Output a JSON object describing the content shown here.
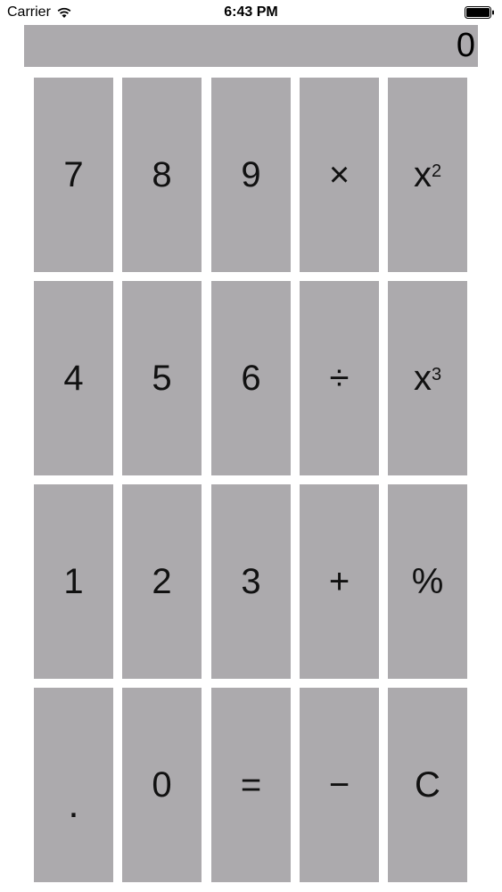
{
  "status_bar": {
    "carrier": "Carrier",
    "time": "6:43 PM"
  },
  "display": {
    "value": "0"
  },
  "keys": [
    {
      "label": "7",
      "name": "key-7"
    },
    {
      "label": "8",
      "name": "key-8"
    },
    {
      "label": "9",
      "name": "key-9"
    },
    {
      "label": "×",
      "name": "key-multiply"
    },
    {
      "label": "x",
      "sup": "2",
      "name": "key-square"
    },
    {
      "label": "4",
      "name": "key-4"
    },
    {
      "label": "5",
      "name": "key-5"
    },
    {
      "label": "6",
      "name": "key-6"
    },
    {
      "label": "÷",
      "name": "key-divide"
    },
    {
      "label": "x",
      "sup": "3",
      "name": "key-cube"
    },
    {
      "label": "1",
      "name": "key-1"
    },
    {
      "label": "2",
      "name": "key-2"
    },
    {
      "label": "3",
      "name": "key-3"
    },
    {
      "label": "+",
      "name": "key-plus"
    },
    {
      "label": "%",
      "name": "key-percent"
    },
    {
      "label": ".",
      "name": "key-decimal"
    },
    {
      "label": "0",
      "name": "key-0"
    },
    {
      "label": "=",
      "name": "key-equals"
    },
    {
      "label": "−",
      "name": "key-minus"
    },
    {
      "label": "C",
      "name": "key-clear"
    }
  ]
}
